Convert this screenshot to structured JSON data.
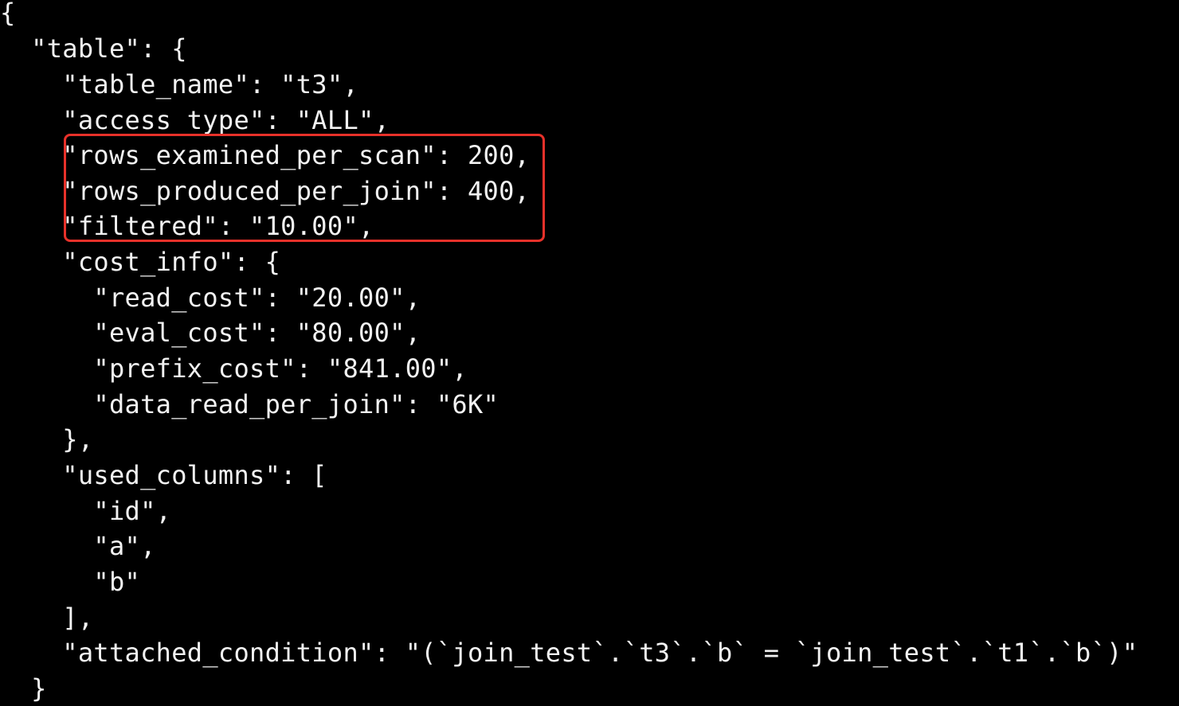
{
  "terminal": {
    "lines": [
      "{",
      "  \"table\": {",
      "    \"table_name\": \"t3\",",
      "    \"access_type\": \"ALL\",",
      "    \"rows_examined_per_scan\": 200,",
      "    \"rows_produced_per_join\": 400,",
      "    \"filtered\": \"10.00\",",
      "    \"cost_info\": {",
      "      \"read_cost\": \"20.00\",",
      "      \"eval_cost\": \"80.00\",",
      "      \"prefix_cost\": \"841.00\",",
      "      \"data_read_per_join\": \"6K\"",
      "    },",
      "    \"used_columns\": [",
      "      \"id\",",
      "      \"a\",",
      "      \"b\"",
      "    ],",
      "    \"attached_condition\": \"(`join_test`.`t3`.`b` = `join_test`.`t1`.`b`)\"",
      "  }"
    ]
  },
  "colors": {
    "background": "#000000",
    "text": "#f2f2f2",
    "highlight_border": "#e8312a"
  }
}
